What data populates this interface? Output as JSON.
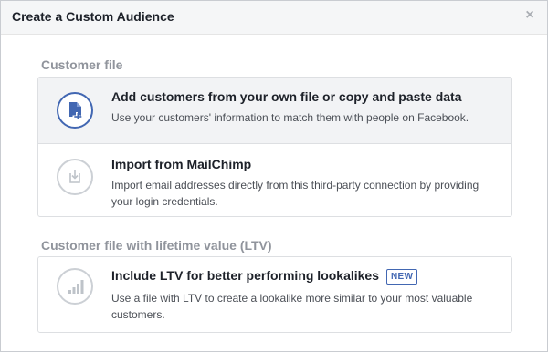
{
  "dialog": {
    "title": "Create a Custom Audience",
    "close_glyph": "×"
  },
  "sections": [
    {
      "title": "Customer file",
      "options": [
        {
          "title": "Add customers from your own file or copy and paste data",
          "description": "Use your customers' information to match them with people on Facebook.",
          "icon": "customer-file-icon",
          "selected": true
        },
        {
          "title": "Import from MailChimp",
          "description": "Import email addresses directly from this third-party connection by providing your login credentials.",
          "icon": "import-icon",
          "selected": false
        }
      ]
    },
    {
      "title": "Customer file with lifetime value (LTV)",
      "options": [
        {
          "title": "Include LTV for better performing lookalikes",
          "badge": "NEW",
          "description": "Use a file with LTV to create a lookalike more similar to your most valuable customers.",
          "icon": "bar-chart-icon",
          "selected": false
        }
      ]
    }
  ],
  "colors": {
    "accent": "#4267b2",
    "selected_bg": "#f2f3f5",
    "muted_text": "#90949c",
    "icon_gray": "#ccd0d5"
  }
}
